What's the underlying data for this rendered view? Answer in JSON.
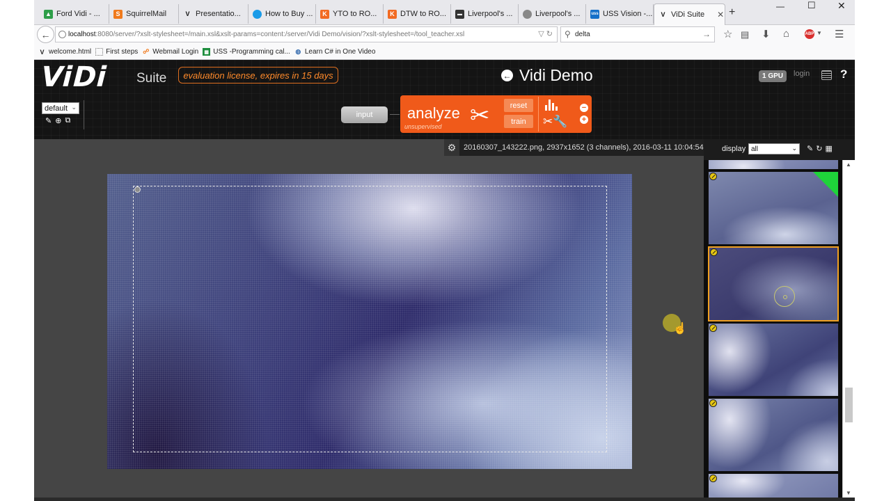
{
  "browser": {
    "tabs": [
      {
        "label": "Ford Vidi - ...",
        "icon": "google-drive-icon",
        "color": "#2e9e49"
      },
      {
        "label": "SquirrelMail",
        "icon": "squirrelmail-icon",
        "color": "#f07a1d"
      },
      {
        "label": "Presentatio...",
        "icon": "vidi-v-icon",
        "color": "#111111"
      },
      {
        "label": "How to Buy ...",
        "icon": "blue-dot-icon",
        "color": "#1a9be8"
      },
      {
        "label": "YTO to RO...",
        "icon": "kayak-icon",
        "color": "#f26a22"
      },
      {
        "label": "DTW to RO...",
        "icon": "kayak-icon",
        "color": "#f26a22"
      },
      {
        "label": "Liverpool's ...",
        "icon": "liverpool-icon",
        "color": "#333333"
      },
      {
        "label": "Liverpool's ...",
        "icon": "liverpool-crest-icon",
        "color": "#888888"
      },
      {
        "label": "USS Vision -...",
        "icon": "uss-icon",
        "color": "#1570c9"
      },
      {
        "label": "ViDi Suite",
        "icon": "vidi-v-icon",
        "color": "#111111",
        "active": true
      }
    ],
    "new_tab": "+",
    "url_host": "localhost",
    "url_rest": ":8080/server/?xslt-stylesheet=/main.xsl&xslt-params=content:/server/Vidi Demo/vision/?xslt-stylesheet=/tool_teacher.xsl",
    "search_value": "delta",
    "bookmarks": [
      {
        "label": "welcome.html",
        "icon": "vidi-v-icon"
      },
      {
        "label": "First steps",
        "icon": "page-icon"
      },
      {
        "label": "Webmail Login",
        "icon": "squirrelmail-icon"
      },
      {
        "label": "USS -Programming cal...",
        "icon": "sheets-icon"
      },
      {
        "label": "Learn C# in One Video",
        "icon": "globe-icon"
      }
    ]
  },
  "app": {
    "logo": "ViDi",
    "suite": "Suite",
    "license": "evaluation license, expires in 15 days",
    "title": "Vidi Demo",
    "gpu": "1 GPU",
    "login": "login",
    "help": "?",
    "workspace_select": "default",
    "pipeline": {
      "input_label": "input",
      "tool_name": "analyze",
      "tool_mode": "unsupervised",
      "reset_label": "reset",
      "train_label": "train"
    },
    "image_info": "20160307_143222.png, 2937x1652 (3 channels), 2016-03-11 10:04:54",
    "display_label": "display",
    "display_value": "all",
    "colors": {
      "accent": "#f05a1a",
      "license_text": "#ff8a2a",
      "selected_border": "#f0a020",
      "good_marker": "#1fd43a",
      "badge": "#e6c613"
    }
  }
}
